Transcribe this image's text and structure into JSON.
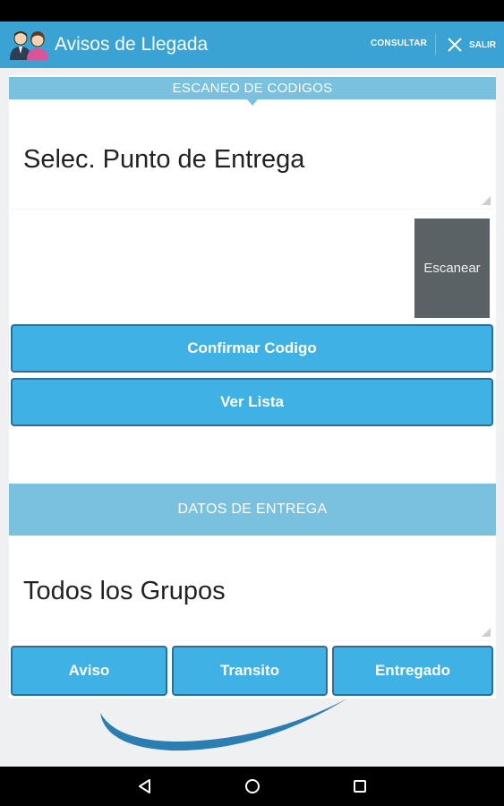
{
  "app": {
    "title": "Avisos de Llegada",
    "icon": "people-icon"
  },
  "action_bar": {
    "consultar_label": "CONSULTAR",
    "salir_label": "SALIR",
    "salir_icon": "close-icon",
    "color": "#3ba3d3"
  },
  "scan_section": {
    "header": "ESCANEO DE CODIGOS",
    "punto_entrega_value": "Selec. Punto de Entrega",
    "code_value": "",
    "scan_button_label": "Escanear",
    "confirm_button_label": "Confirmar Codigo",
    "list_button_label": "Ver Lista"
  },
  "delivery_section": {
    "header": "DATOS DE ENTREGA",
    "groups_value": "Todos los Grupos",
    "tabs": [
      {
        "label": "Aviso"
      },
      {
        "label": "Transito"
      },
      {
        "label": "Entregado"
      }
    ]
  },
  "navigation": {
    "back_icon": "back-triangle-icon",
    "home_icon": "home-circle-icon",
    "recents_icon": "recents-square-icon"
  },
  "colors": {
    "header_blue": "#79c1df",
    "button_blue": "#3fb1e4",
    "scan_gray": "#5a6266"
  }
}
